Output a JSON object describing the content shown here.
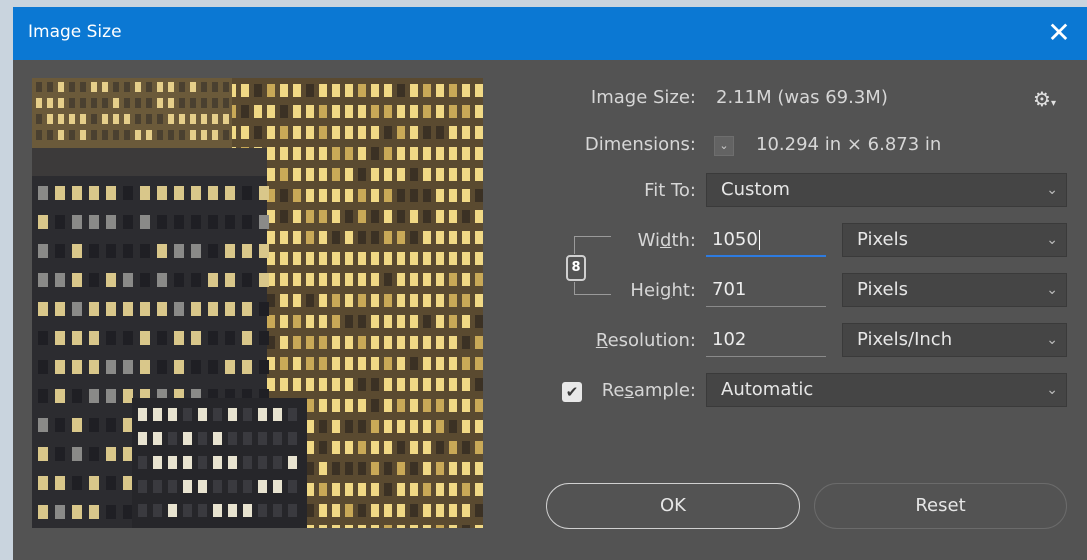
{
  "window": {
    "title": "Image Size",
    "close_glyph": "✕"
  },
  "preview": {
    "description_icon": "image-preview"
  },
  "info": {
    "image_size_label": "Image Size:",
    "image_size_value": "2.11M (was 69.3M)",
    "dimensions_label": "Dimensions:",
    "dimensions_value": "10.294 in  ×  6.873 in",
    "gear_icon": "gear-icon"
  },
  "fit_to": {
    "label": "Fit To:",
    "value": "Custom"
  },
  "width": {
    "label_pre": "Wi",
    "label_u": "d",
    "label_post": "th:",
    "value": "1050",
    "unit": "Pixels"
  },
  "height": {
    "label_pre": "Hei",
    "label_u": "g",
    "label_post": "ht:",
    "value": "701",
    "unit": "Pixels"
  },
  "resolution": {
    "label_u": "R",
    "label_post": "esolution:",
    "value": "102",
    "unit": "Pixels/Inch"
  },
  "resample": {
    "label_pre": "Re",
    "label_u": "s",
    "label_post": "ample:",
    "checked": true,
    "value": "Automatic"
  },
  "buttons": {
    "ok": "OK",
    "reset": "Reset"
  },
  "colors": {
    "titlebar": "#0b78d3",
    "dialog_bg": "#535353",
    "focus": "#2d7be0"
  }
}
